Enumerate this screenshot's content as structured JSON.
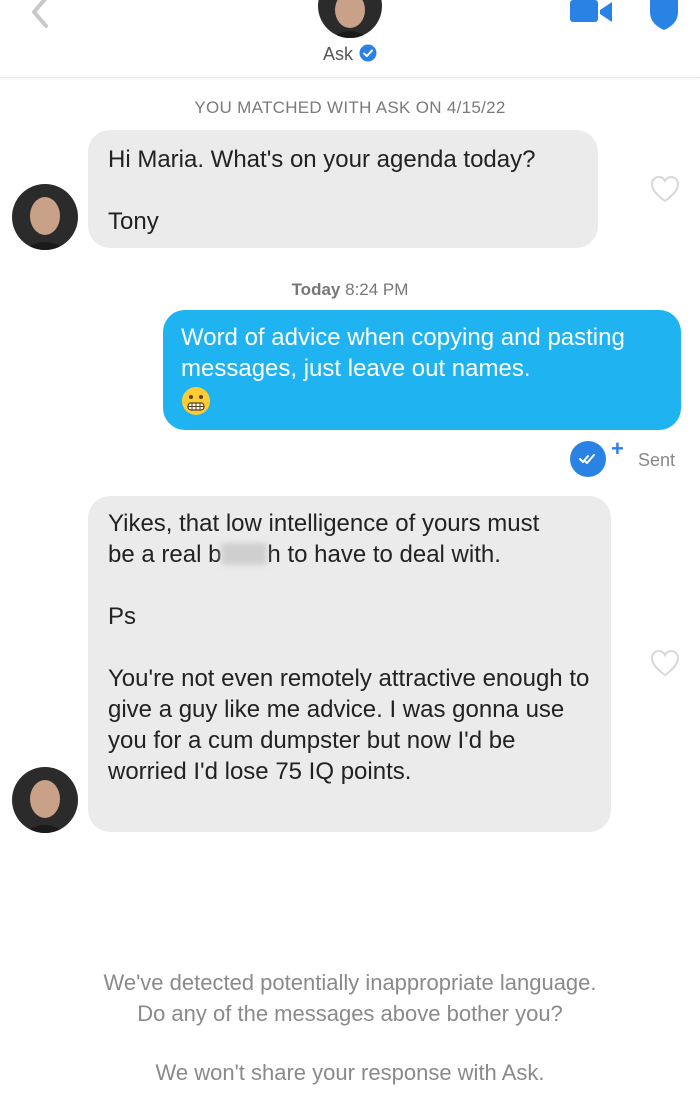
{
  "header": {
    "match_name": "Ask",
    "icons": [
      "back-chevron-icon",
      "video-call-icon",
      "shield-icon",
      "verified-check-icon"
    ]
  },
  "match_banner": "YOU MATCHED WITH ASK ON 4/15/22",
  "messages": [
    {
      "direction": "incoming",
      "paragraphs": [
        "Hi Maria. What's on your agenda today?",
        "Tony"
      ]
    },
    {
      "direction": "outgoing",
      "text": "Word of advice when copying and pasting messages, just leave out names.",
      "emoji": "grimacing-face-icon",
      "status": "Sent"
    },
    {
      "direction": "incoming",
      "line1": "Yikes, that low intelligence of yours must",
      "line2_start": "be a real b",
      "line2_end": "h to have to deal with.",
      "paragraphs": [
        "Ps",
        "You're not even remotely attractive enough to give a guy like me advice. I was gonna use you for a cum dumpster but now I'd be worried I'd lose 75 IQ points."
      ]
    }
  ],
  "timestamp": {
    "day": "Today",
    "time": "8:24 PM"
  },
  "receipt_plus": "+",
  "footer": {
    "warning_line1": "We've detected potentially inappropriate language.",
    "warning_line2": "Do any of the messages above bother you?",
    "privacy_note": "We won't share your response with Ask."
  },
  "colors": {
    "outgoing_bubble": "#1fb3f2",
    "incoming_bubble": "#ebebeb",
    "accent_blue": "#2a82e4"
  }
}
